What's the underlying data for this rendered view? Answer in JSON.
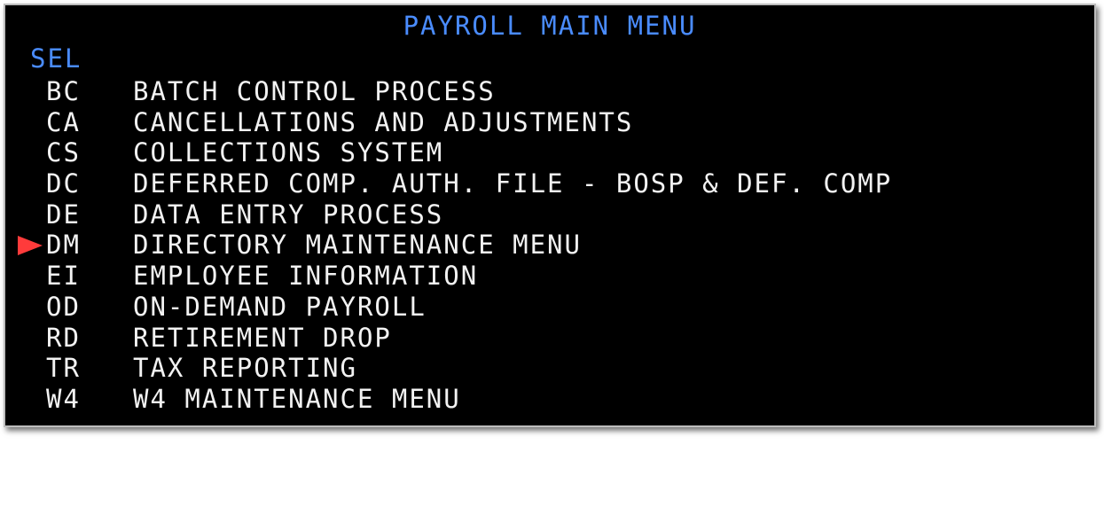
{
  "screen": {
    "title": "PAYROLL MAIN MENU",
    "selection_label": "SEL",
    "colors": {
      "background": "#000000",
      "header_text": "#4a8cff",
      "menu_text": "#f2f2f2",
      "pointer": "#ff3b3b"
    }
  },
  "menu": {
    "items": [
      {
        "code": "BC",
        "label": "BATCH CONTROL PROCESS"
      },
      {
        "code": "CA",
        "label": "CANCELLATIONS AND ADJUSTMENTS"
      },
      {
        "code": "CS",
        "label": "COLLECTIONS SYSTEM"
      },
      {
        "code": "DC",
        "label": "DEFERRED COMP. AUTH. FILE - BOSP & DEF. COMP"
      },
      {
        "code": "DE",
        "label": "DATA ENTRY PROCESS"
      },
      {
        "code": "DM",
        "label": "DIRECTORY MAINTENANCE MENU",
        "pointer_icon": "red-triangle-pointer"
      },
      {
        "code": "EI",
        "label": "EMPLOYEE INFORMATION"
      },
      {
        "code": "OD",
        "label": "ON-DEMAND PAYROLL"
      },
      {
        "code": "RD",
        "label": "RETIREMENT DROP"
      },
      {
        "code": "TR",
        "label": "TAX REPORTING"
      },
      {
        "code": "W4",
        "label": "W4 MAINTENANCE MENU"
      }
    ]
  }
}
